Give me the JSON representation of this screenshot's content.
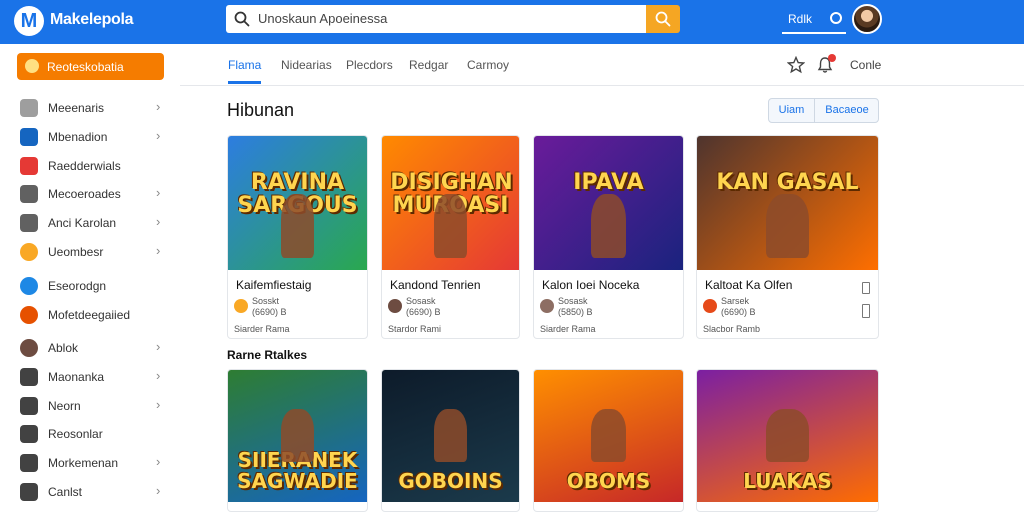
{
  "app": {
    "logo_letter": "M",
    "name": "Makelepola"
  },
  "search": {
    "value": "Unoskaun Apoeinessa"
  },
  "topbar": {
    "link_label": "Rdlk"
  },
  "sidebar": {
    "promo_label": "Reoteskobatia",
    "items": [
      {
        "label": "Meeenaris",
        "icon": "grid-icon",
        "color": "#9e9e9e",
        "chevron": true
      },
      {
        "label": "Mbenadion",
        "icon": "square-icon",
        "color": "#1565c0",
        "chevron": true
      },
      {
        "label": "Raedderwials",
        "icon": "shapes-icon",
        "color": "#e53935",
        "chevron": false
      },
      {
        "label": "Mecoeroades",
        "icon": "gamepad-icon",
        "color": "#616161",
        "chevron": true
      },
      {
        "label": "Anci Karolan",
        "icon": "card-icon",
        "color": "#616161",
        "chevron": true
      },
      {
        "label": "Ueombesr",
        "icon": "coin-icon",
        "color": "#f9a825",
        "chevron": true
      },
      {
        "label": "Eseorodgn",
        "icon": "globe-icon",
        "color": "#1e88e5",
        "chevron": false
      },
      {
        "label": "Mofetdeegaiied",
        "icon": "mask-icon",
        "color": "#e65100",
        "chevron": false
      },
      {
        "label": "Ablok",
        "icon": "avatar-icon",
        "color": "#6d4c41",
        "chevron": true
      },
      {
        "label": "Maonanka",
        "icon": "tag-icon",
        "color": "#424242",
        "chevron": true
      },
      {
        "label": "Neorn",
        "icon": "box-icon",
        "color": "#424242",
        "chevron": true
      },
      {
        "label": "Reosonlar",
        "icon": "person-icon",
        "color": "#424242",
        "chevron": false
      },
      {
        "label": "Morkemenan",
        "icon": "layers-icon",
        "color": "#424242",
        "chevron": true
      },
      {
        "label": "Canlst",
        "icon": "list-icon",
        "color": "#424242",
        "chevron": true
      }
    ]
  },
  "nav": {
    "tabs": [
      {
        "label": "Flama",
        "active": true
      },
      {
        "label": "Nidearias",
        "active": false
      },
      {
        "label": "Plecdors",
        "active": false
      },
      {
        "label": "Redgar",
        "active": false
      },
      {
        "label": "Carmoy",
        "active": false
      }
    ],
    "right_link": "Conle"
  },
  "section1": {
    "title": "Hibunan",
    "toggle": [
      "Uiam",
      "Bacaeoe"
    ],
    "cards": [
      {
        "image_title": "RAVINA SARGOUS",
        "name": "Kaifemfiestaig",
        "meta1": "Sosskt",
        "meta2": "(6690) B",
        "meta3": "Siarder Rama",
        "colors": [
          "#2d7de0",
          "#2aa84f"
        ],
        "icon_color": "#f9a825",
        "bookmarks": 0
      },
      {
        "image_title": "DISIGHAN MUROASI",
        "name": "Kandond Tenrien",
        "meta1": "Sosask",
        "meta2": "(6690) B",
        "meta3": "Stardor Rami",
        "colors": [
          "#ff8a00",
          "#e53935"
        ],
        "icon_color": "#6d4c41",
        "bookmarks": 0
      },
      {
        "image_title": "IPAVA",
        "name": "Kalon Ioei Noceka",
        "meta1": "Sosask",
        "meta2": "(5850) B",
        "meta3": "Siarder Rama",
        "colors": [
          "#6a1b9a",
          "#1a237e"
        ],
        "icon_color": "#8d6e63",
        "bookmarks": 0
      },
      {
        "image_title": "KAN GASAL",
        "name": "Kaltoat Ka Olfen",
        "meta1": "Sarsek",
        "meta2": "(6690) B",
        "meta3": "Slacbor Ramb",
        "colors": [
          "#4e342e",
          "#ff6f00"
        ],
        "icon_color": "#e64a19",
        "bookmarks": 2
      }
    ]
  },
  "section2": {
    "title": "Rarne Rtalkes",
    "cards": [
      {
        "image_title": "SIIERANEK SAGWADIE",
        "colors": [
          "#2e7d32",
          "#1565c0"
        ]
      },
      {
        "image_title": "GOBOINS",
        "colors": [
          "#0d1b2a",
          "#1b3a4b"
        ]
      },
      {
        "image_title": "OBOMS",
        "colors": [
          "#ff8f00",
          "#c62828"
        ]
      },
      {
        "image_title": "LUAKAS",
        "colors": [
          "#7b1fa2",
          "#ff6d00"
        ]
      }
    ]
  }
}
